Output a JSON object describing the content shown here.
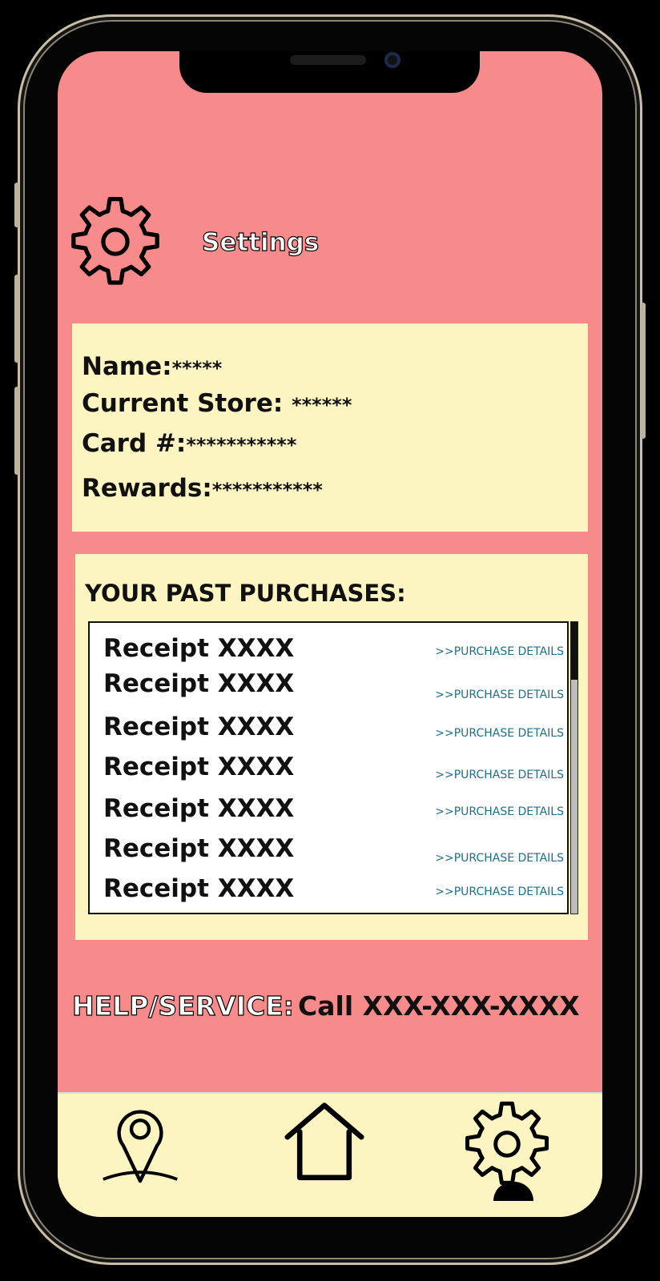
{
  "header": {
    "title": "Settings",
    "icon": "gear-icon"
  },
  "account": {
    "name_label": "Name:",
    "name_value": "*****",
    "store_label": "Current Store:",
    "store_value": "******",
    "card_label": "Card #:",
    "card_value": "***********",
    "rewards_label": "Rewards:",
    "rewards_value": "***********"
  },
  "purchases": {
    "title": "YOUR PAST PURCHASES:",
    "items": [
      {
        "label": "Receipt XXXX",
        "link": ">>PURCHASE DETAILS"
      },
      {
        "label": "Receipt XXXX",
        "link": ">>PURCHASE DETAILS"
      },
      {
        "label": "Receipt XXXX",
        "link": ">>PURCHASE DETAILS"
      },
      {
        "label": "Receipt XXXX",
        "link": ">>PURCHASE DETAILS"
      },
      {
        "label": "Receipt XXXX",
        "link": ">>PURCHASE DETAILS"
      },
      {
        "label": "Receipt XXXX",
        "link": ">>PURCHASE DETAILS"
      },
      {
        "label": "Receipt XXXX",
        "link": ">>PURCHASE DETAILS"
      }
    ]
  },
  "help": {
    "label": "HELP/SERVICE:",
    "value": "Call XXX-XXX-XXXX"
  },
  "nav": {
    "items": [
      "location-pin-icon",
      "home-icon",
      "gear-icon"
    ]
  },
  "colors": {
    "background": "#f78b8b",
    "card": "#fdf5c1",
    "link": "#1f6e8c"
  }
}
